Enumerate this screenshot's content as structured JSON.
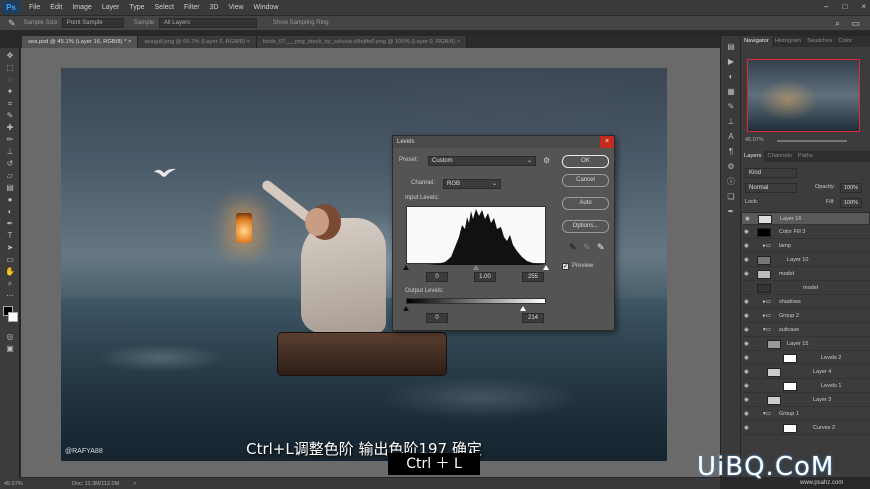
{
  "menubar": {
    "app_icon": "Ps",
    "items": [
      "File",
      "Edit",
      "Image",
      "Layer",
      "Type",
      "Select",
      "Filter",
      "3D",
      "View",
      "Window"
    ],
    "window_controls": [
      "–",
      "□",
      "×"
    ]
  },
  "options": {
    "sample_size_label": "Sample Size:",
    "sample_size_value": "Point Sample",
    "sample_label": "Sample:",
    "sample_value": "All Layers",
    "show_ring": "Show Sampling Ring"
  },
  "tabs": [
    {
      "label": "sea.psd @ 45.1% (Layer 16, RGB/8) *",
      "close": "×"
    },
    {
      "label": "seagull.png @ 66.7% (Layer 0, RGB/8)",
      "close": "×"
    },
    {
      "label": "birds_07___png_stock_by_selusia-d9ejtfo0.png @ 100% (Layer 0, RGB/8)",
      "close": "×"
    }
  ],
  "canvas": {
    "handle": "@RAFYA88",
    "subtitle": "Ctrl+L调整色阶  输出色阶197  确定"
  },
  "shortcut": "Ctrl ＋ L",
  "status": {
    "zoom": "45.07%",
    "doc": "Doc: 11.3M/112.0M",
    "arrow": ">"
  },
  "levels": {
    "title": "Levels",
    "close": "×",
    "preset_label": "Preset:",
    "preset_value": "Custom",
    "channel_label": "Channel:",
    "channel_value": "RGB",
    "input_label": "Input Levels:",
    "input_black": "0",
    "input_gamma": "1.00",
    "input_white": "255",
    "output_label": "Output Levels:",
    "output_black": "0",
    "output_white": "214",
    "ok": "OK",
    "cancel": "Cancel",
    "auto": "Auto",
    "options": "Options...",
    "preview_label": "Preview",
    "preview_checked": true,
    "check_mark": "✓",
    "eyedroppers": [
      "black-eyedropper",
      "gray-eyedropper",
      "white-eyedropper"
    ]
  },
  "navigator": {
    "tabs": [
      "Navigator",
      "Histogram",
      "Swatches",
      "Color"
    ],
    "zoom": "45.07%"
  },
  "layers_panel": {
    "tabs": [
      "Layers",
      "Channels",
      "Paths"
    ],
    "kind": "Kind",
    "blend": "Normal",
    "opacity_label": "Opacity:",
    "opacity": "100%",
    "lock_label": "Lock:",
    "fill_label": "Fill:",
    "fill": "100%",
    "layers": [
      {
        "name": "Layer 16",
        "selected": true
      },
      {
        "name": "Color Fill 3",
        "selected": false
      },
      {
        "name": "lamp",
        "selected": false
      },
      {
        "name": "Layer 10",
        "selected": false
      },
      {
        "name": "model",
        "selected": false
      },
      {
        "name": "model",
        "selected": false
      },
      {
        "name": "shadows",
        "selected": false
      },
      {
        "name": "Group 2",
        "selected": false
      },
      {
        "name": "suitcase",
        "selected": false
      },
      {
        "name": "Layer 15",
        "selected": false
      },
      {
        "name": "Levels 2",
        "selected": false
      },
      {
        "name": "Layer 4",
        "selected": false
      },
      {
        "name": "Levels 1",
        "selected": false
      },
      {
        "name": "Layer 3",
        "selected": false
      },
      {
        "name": "Group 1",
        "selected": false
      },
      {
        "name": "Curves 2",
        "selected": false
      }
    ]
  },
  "watermark": {
    "main": "UiBQ.CoM",
    "sub": "www.psahz.com"
  },
  "colors": {
    "accent": "#0a64c8",
    "close_red": "#c42b1c",
    "nav_frame": "#e0262f"
  }
}
